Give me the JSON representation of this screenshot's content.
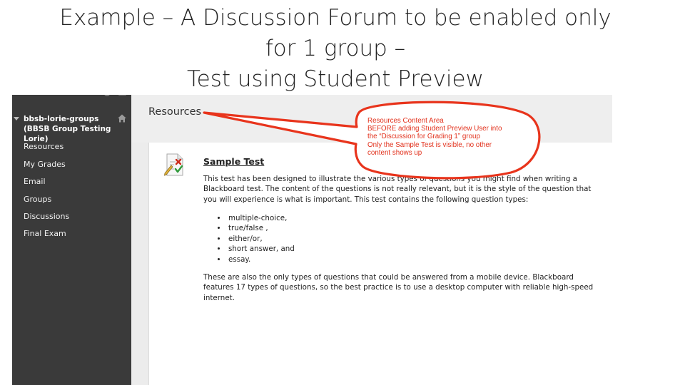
{
  "slide": {
    "title_lines": [
      "Example – A Discussion Forum to be enabled only",
      "for 1 group –",
      "Test using Student Preview"
    ]
  },
  "sidebar": {
    "course_title": "bbsb-lorie-groups (BBSB Group Testing Lorie)",
    "items": [
      {
        "label": "Resources"
      },
      {
        "label": "My Grades"
      },
      {
        "label": "Email"
      },
      {
        "label": "Groups"
      },
      {
        "label": "Discussions"
      },
      {
        "label": "Final Exam"
      }
    ]
  },
  "content": {
    "title": "Resources",
    "item": {
      "title": "Sample Test",
      "description": "This test has been designed to illustrate the various types of questions you might find when writing a Blackboard test.  The content of the questions is not really relevant, but it is the style of the question that you will experience is what is important.  This test contains the following question types:",
      "question_types": [
        "multiple-choice,",
        "true/false ,",
        "either/or,",
        "short answer, and",
        "essay."
      ],
      "note": "These are also the only types of questions that could be answered from a mobile device.  Blackboard features 17 types of questions, so the best practice is to use a desktop computer with reliable high-speed internet."
    }
  },
  "callout": {
    "lines": [
      "Resources Content Area",
      "BEFORE adding Student Preview User into",
      "the “Discussion for Grading 1” group",
      "Only the Sample Test is visible, no other",
      "content shows up"
    ],
    "color": "#e8341c"
  },
  "icons": {
    "home": "home-icon",
    "test": "test-document-icon",
    "caret": "caret-down-icon"
  }
}
